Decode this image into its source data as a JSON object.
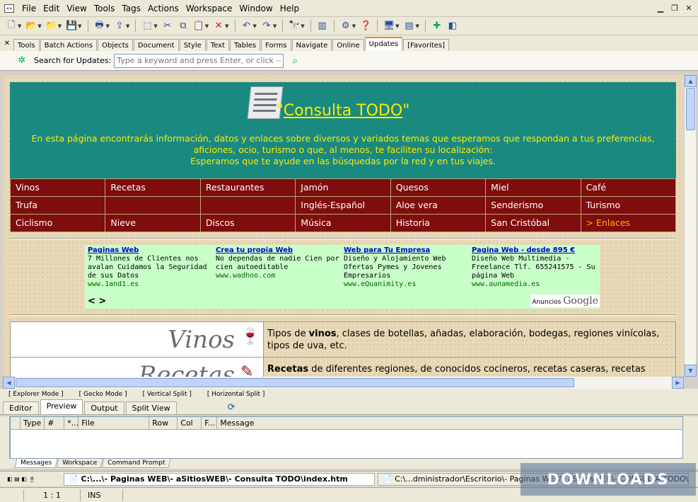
{
  "menubar": {
    "items": [
      "File",
      "Edit",
      "View",
      "Tools",
      "Tags",
      "Actions",
      "Workspace",
      "Window",
      "Help"
    ]
  },
  "tabs": {
    "items": [
      "Tools",
      "Batch Actions",
      "Objects",
      "Document",
      "Style",
      "Text",
      "Tables",
      "Forms",
      "Navigate",
      "Online",
      "Updates",
      "[Favorites]"
    ],
    "active": "Updates"
  },
  "search": {
    "label": "Search for Updates:",
    "placeholder": "Type a keyword and press Enter, or click -->"
  },
  "page": {
    "title": "Consulta TODO",
    "quote_open": "\"",
    "quote_close": "\"",
    "intro_line1": "En esta página encontrarás información, datos y enlaces sobre diversos y variados temas que esperamos que respondan a tus preferencias,",
    "intro_line2": "aficiones, ocio, turismo o que, al menos, te faciliten su localización:",
    "intro_line3": "Esperamos que te ayude en las búsquedas por la red y en tus viajes.",
    "nav": [
      [
        "Vinos",
        "Recetas",
        "Restaurantes",
        "Jamón",
        "Quesos",
        "Miel",
        "Café"
      ],
      [
        "Trufa",
        "",
        "",
        "Inglés-Español",
        "Aloe vera",
        "Senderismo",
        "Turismo"
      ],
      [
        "Ciclismo",
        "Nieve",
        "Discos",
        "Música",
        "Historia",
        "San Cristóbal",
        "> Enlaces"
      ]
    ],
    "ads": [
      {
        "title": "Paginas Web",
        "text": "7 Millones de Clientes nos avalan Cuidamos la Seguridad de sus Datos",
        "url": "www.1and1.es"
      },
      {
        "title": "Crea tu propia Web",
        "text": "No dependas de nadie Cien por cien autoeditable",
        "url": "www.wadhoo.com"
      },
      {
        "title": "Web para Tu Empresa",
        "text": "Diseño y Alojamiento Web Ofertas Pymes y Jovenes Empresarios",
        "url": "www.eQuanimity.es"
      },
      {
        "title": "Pagina Web - desde 895 €",
        "text": "Diseño Web Multimedia - Freelance Tlf. 655241575 - Su página Web",
        "url": "www.aunamedia.es"
      }
    ],
    "ads_nav": "< >",
    "ads_by": "Anuncios",
    "ads_brand": "Google",
    "categories": [
      {
        "name": "Vinos",
        "desc_pre": "Tipos de ",
        "desc_bold": "vinos",
        "desc_post": ", clases de botellas, añadas, elaboración, bodegas, regiones vinícolas, tipos de uva, etc."
      },
      {
        "name": "Recetas",
        "desc_pre": "",
        "desc_bold": "Recetas",
        "desc_post": " de diferentes regiones, de conocidos cocineros, recetas caseras, recetas"
      }
    ]
  },
  "modes": [
    "[ Explorer Mode ]",
    "[ Gecko Mode ]",
    "[ Vertical Split ]",
    "[ Horizontal Split ]"
  ],
  "viewtabs": {
    "items": [
      "Editor",
      "Preview",
      "Output",
      "Split View"
    ],
    "active": "Preview"
  },
  "messages": {
    "columns": [
      "Type",
      "#",
      "*...",
      "File",
      "Row",
      "Col",
      "F...",
      "Message"
    ]
  },
  "bottomtabs": {
    "items": [
      "Messages",
      "Workspace",
      "Command Prompt"
    ],
    "active": "Messages"
  },
  "doctabs": {
    "active": "C:\\...\\- Paginas WEB\\- aSitiosWEB\\- Consulta TODO\\index.htm",
    "other": "C:\\...dministrador\\Escritorio\\- Paginas WEB\\- aSitiosWEB\\- CONSULTA TODO\\- aSitios\\index.htm"
  },
  "status": {
    "position": "1 : 1",
    "mode": "INS"
  },
  "watermark": "DOWNLOADS GURU"
}
